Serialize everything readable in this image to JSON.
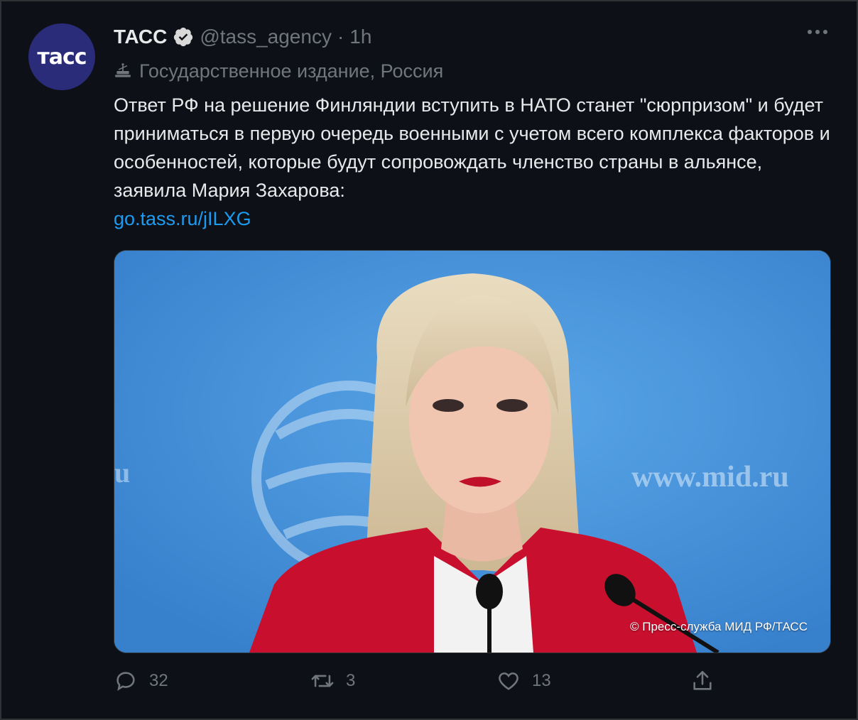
{
  "account": {
    "name": "ТАСС",
    "handle": "@tass_agency",
    "separator": "·",
    "time": "1h",
    "avatar_text": "тасс",
    "label": "Государственное издание, Россия"
  },
  "tweet": {
    "text": "Ответ РФ на решение Финляндии вступить в НАТО станет \"сюрпризом\" и будет приниматься в первую очередь военными с учетом всего комплекса факторов и особенностей, которые будут сопровождать членство страны в альянсе, заявила Мария Захарова:",
    "link": "go.tass.ru/jILXG"
  },
  "media": {
    "credit": "© Пресс-служба МИД РФ/ТАСС",
    "background_text": "www.mid.ru",
    "background_text_left": "u"
  },
  "actions": {
    "replies": "32",
    "retweets": "3",
    "likes": "13"
  },
  "colors": {
    "accent": "#1d9bf0",
    "avatar": "#2a2c7a",
    "jacket": "#c8102e"
  }
}
